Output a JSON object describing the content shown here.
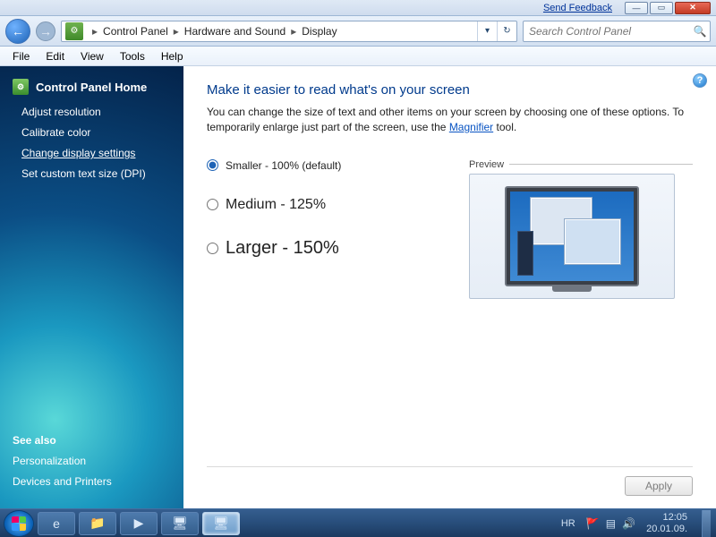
{
  "titlebar": {
    "feedback": "Send Feedback"
  },
  "breadcrumbs": {
    "root": "Control Panel",
    "mid": "Hardware and Sound",
    "leaf": "Display"
  },
  "search": {
    "placeholder": "Search Control Panel"
  },
  "menus": {
    "file": "File",
    "edit": "Edit",
    "view": "View",
    "tools": "Tools",
    "help": "Help"
  },
  "sidebar": {
    "home": "Control Panel Home",
    "links": {
      "resolution": "Adjust resolution",
      "calibrate": "Calibrate color",
      "change": "Change display settings",
      "dpi": "Set custom text size (DPI)"
    },
    "seealso_head": "See also",
    "seealso": {
      "personalization": "Personalization",
      "devices": "Devices and Printers"
    }
  },
  "page": {
    "title": "Make it easier to read what's on your screen",
    "desc_a": "You can change the size of text and other items on your screen by choosing one of these options. To temporarily enlarge just part of the screen, use the ",
    "magnifier": "Magnifier",
    "desc_b": " tool.",
    "opt_small": "Smaller - 100% (default)",
    "opt_med": "Medium - 125%",
    "opt_large": "Larger - 150%",
    "preview": "Preview",
    "apply": "Apply"
  },
  "tray": {
    "lang": "HR",
    "time": "12:05",
    "date": "20.01.09."
  }
}
